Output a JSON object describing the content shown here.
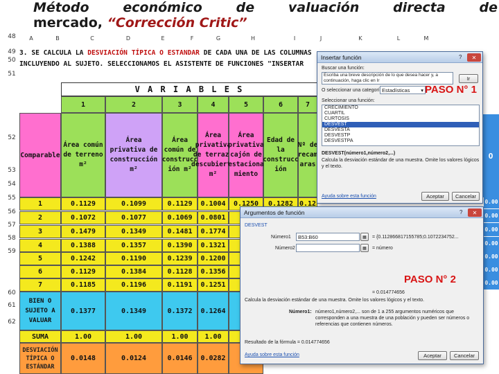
{
  "title": {
    "line1_words": [
      "Método",
      "económico",
      "de",
      "valuación",
      "directa",
      "de"
    ],
    "line2_prefix": "mercado, ",
    "line2_quote": "“Corrección Critic”"
  },
  "columns": [
    "A",
    "B",
    "C",
    "D",
    "E",
    "F",
    "G",
    "H",
    "I",
    "J",
    "K",
    "L",
    "M"
  ],
  "rows": [
    "48",
    "49",
    "50",
    "51",
    "52",
    "53",
    "54",
    "55",
    "56",
    "57",
    "58",
    "59",
    "60",
    "61",
    "62"
  ],
  "note": {
    "part1": "3. SE CALCULA LA ",
    "highlight": "DESVIACIÓN TÍPICA O ESTANDAR",
    "part2": " DE CADA UNA DE LAS COLUMNAS",
    "line2": "INCLUYENDO AL SUJETO. SELECCIONAMOS EL ASISTENTE DE FUNCIONES \"INSERTAR"
  },
  "table": {
    "variables_label": "V A R I A B L E S",
    "numbers": [
      "1",
      "2",
      "3",
      "4",
      "5",
      "6",
      "7"
    ],
    "comparable_label": "Comparable",
    "headers": [
      "Área común de terreno m²",
      "Área privativa de construcción m²",
      "Área común de construcc ión m²",
      "Área privativa de terraza descubierta m²",
      "Área privativa cajón de estaciona miento",
      "Edad de la construcc ión",
      "Nº de recam aras"
    ],
    "comparables": [
      "1",
      "2",
      "3",
      "4",
      "5",
      "6",
      "7"
    ],
    "values": [
      [
        "0.1129",
        "0.1099",
        "0.1129",
        "0.1004",
        "0.1250",
        "0.1282",
        "0.12"
      ],
      [
        "0.1072",
        "0.1077",
        "0.1069",
        "0.0801",
        "0.1"
      ],
      [
        "0.1479",
        "0.1349",
        "0.1481",
        "0.1774",
        "0."
      ],
      [
        "0.1388",
        "0.1357",
        "0.1390",
        "0.1321",
        "0."
      ],
      [
        "0.1242",
        "0.1190",
        "0.1239",
        "0.1200",
        "0."
      ],
      [
        "0.1129",
        "0.1384",
        "0.1128",
        "0.1356",
        "0."
      ],
      [
        "0.1185",
        "0.1196",
        "0.1191",
        "0.1251",
        "0."
      ]
    ],
    "subject_label": "BIEN O SUJETO A VALUAR",
    "subject_values": [
      "0.1377",
      "0.1349",
      "0.1372",
      "0.1264",
      "0."
    ],
    "suma_label": "SUMA",
    "suma_values": [
      "1.00",
      "1.00",
      "1.00",
      "1.00",
      "1"
    ],
    "desv_label": "DESVIACIÓN TÍPICA O ESTÁNDAR",
    "desv_values": [
      "0.0148",
      "0.0124",
      "0.0146",
      "0.0282",
      "0.0"
    ],
    "right_values": [
      "0.00",
      "0.00",
      "0.00",
      "0.00",
      "0.00",
      "0.00",
      "0.00"
    ],
    "right_letter": "O"
  },
  "dialog1": {
    "title": "Insertar función",
    "search_label": "Buscar una función:",
    "search_value": "Escriba una breve descripción de lo que desea hacer y, a continuación, haga clic en Ir",
    "go_button": "Ir",
    "category_label": "O seleccionar una categoría:",
    "category_value": "Estadísticas",
    "paso": "PASO N° 1",
    "function_label": "Seleccionar una función:",
    "functions": [
      "CRECIMIENTO",
      "CUARTIL",
      "CURTOSIS",
      "DESVEST",
      "DESVESTA",
      "DESVESTP",
      "DESVESTPA"
    ],
    "selected_index": 3,
    "signature": "DESVEST(número1,número2,...)",
    "description": "Calcula la desviación estándar de una muestra. Omite los valores lógicos y el texto.",
    "help_link": "Ayuda sobre esta función",
    "ok_button": "Aceptar",
    "cancel_button": "Cancelar"
  },
  "dialog2": {
    "title": "Argumentos de función",
    "function_name": "DESVEST",
    "arg1_label": "Número1",
    "arg1_value": "B53:B60",
    "arg1_result": "= {0.112866817155785;0.1072234752...",
    "arg2_label": "Número2",
    "arg2_result": "= número",
    "paso": "PASO N° 2",
    "result_eq": "= 0.014774656",
    "description": "Calcula la desviación estándar de una muestra. Omite los valores lógicos y el texto.",
    "arg_help_label": "Número1:",
    "arg_help": "número1,número2,... son de 1 a 255 argumentos numéricos que corresponden a una muestra de una población y pueden ser números o referencias que contienen números.",
    "formula_result": "Resultado de la fórmula = 0.014774656",
    "help_link": "Ayuda sobre esta función",
    "ok_button": "Aceptar",
    "cancel_button": "Cancelar"
  }
}
